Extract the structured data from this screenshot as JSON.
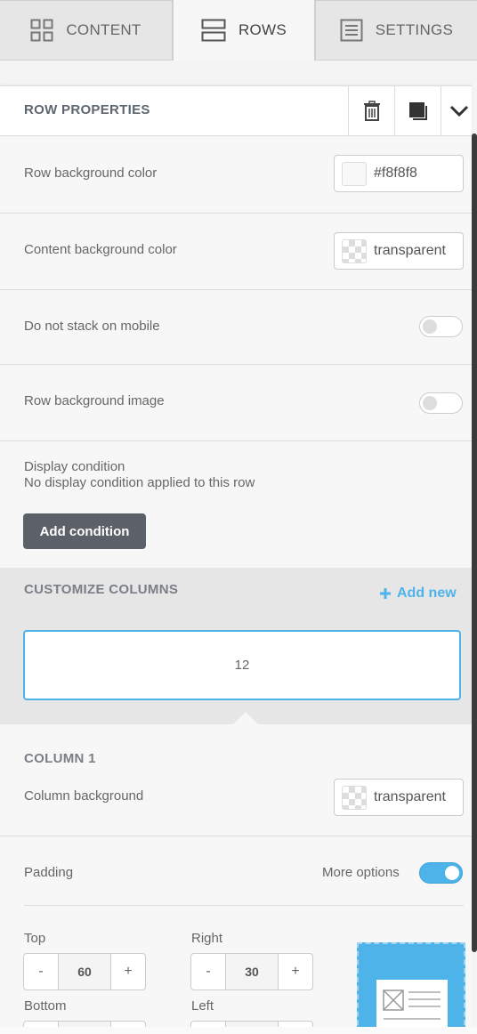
{
  "tabs": [
    {
      "label": "CONTENT",
      "icon": "grid-icon"
    },
    {
      "label": "ROWS",
      "icon": "rows-icon"
    },
    {
      "label": "SETTINGS",
      "icon": "settings-doc-icon"
    }
  ],
  "row_properties": {
    "title": "ROW PROPERTIES",
    "actions": [
      "trash-icon",
      "duplicate-icon",
      "chevron-down-icon"
    ]
  },
  "properties": {
    "row_bg_label": "Row background color",
    "row_bg_value": "#f8f8f8",
    "content_bg_label": "Content background color",
    "content_bg_value": "transparent",
    "no_stack_label": "Do not stack on mobile",
    "no_stack_on": false,
    "bg_image_label": "Row background image",
    "bg_image_on": false,
    "display_condition_label": "Display condition",
    "display_condition_desc": "No display condition applied to this row",
    "add_condition_label": "Add condition"
  },
  "customize": {
    "title": "CUSTOMIZE COLUMNS",
    "add_new_label": "Add new",
    "columns": [
      "12"
    ]
  },
  "column1": {
    "title": "COLUMN 1",
    "bg_label": "Column background",
    "bg_value": "transparent"
  },
  "padding": {
    "label": "Padding",
    "more_options_label": "More options",
    "more_options_on": true,
    "top_label": "Top",
    "top_value": "60",
    "right_label": "Right",
    "right_value": "30",
    "bottom_label": "Bottom",
    "left_label": "Left",
    "minus": "-",
    "plus": "+"
  },
  "colors": {
    "accent": "#4eb3e8",
    "dark_button": "#5c6068",
    "background": "#f7f7f7"
  }
}
